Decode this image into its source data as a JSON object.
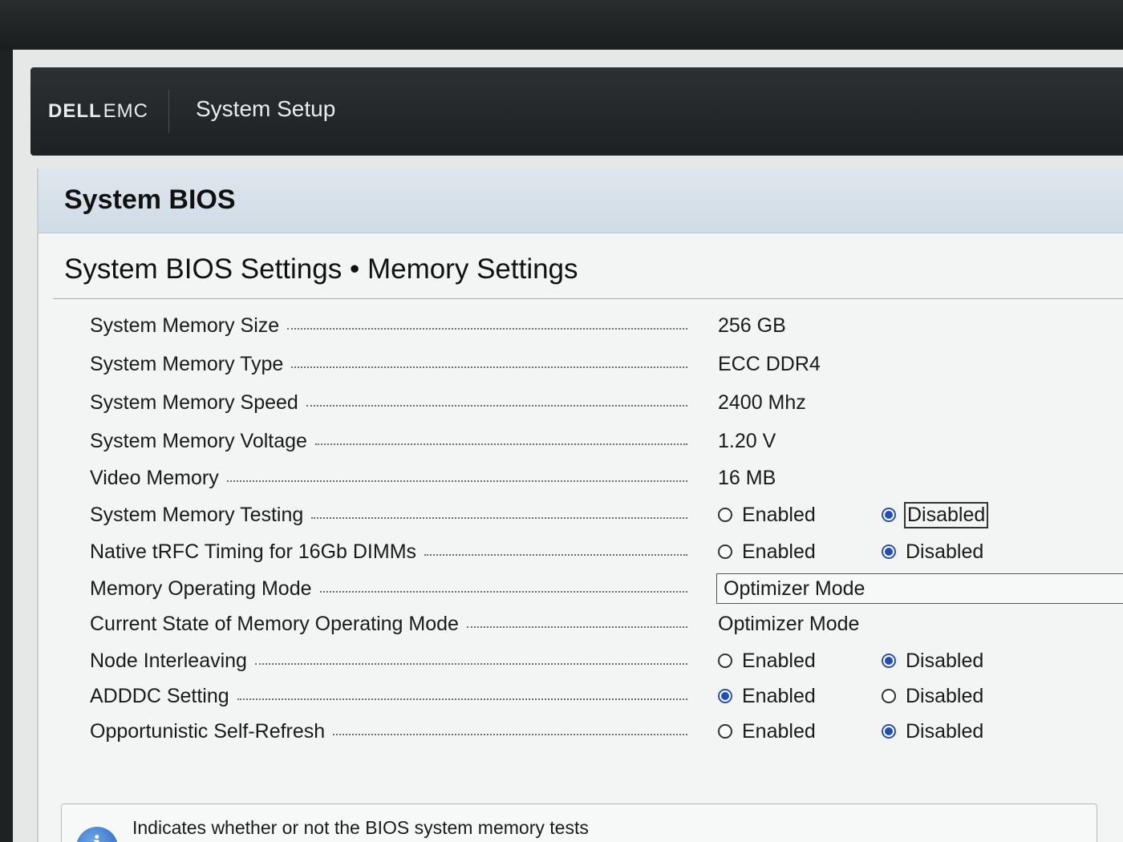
{
  "header": {
    "brand_dell": "DELL",
    "brand_emc": "EMC",
    "title": "System Setup"
  },
  "panel": {
    "title": "System BIOS",
    "page_title": "System BIOS Settings • Memory Settings"
  },
  "settings": [
    {
      "label": "System Memory Size",
      "value": "256 GB"
    },
    {
      "label": "System Memory Type",
      "value": "ECC DDR4"
    },
    {
      "label": "System Memory Speed",
      "value": "2400 Mhz"
    },
    {
      "label": "System Memory Voltage",
      "value": "1.20 V"
    },
    {
      "label": "Video Memory",
      "value": "16 MB"
    },
    {
      "label": "System Memory Testing",
      "opt1": "Enabled",
      "opt2": "Disabled",
      "selected": "Disabled"
    },
    {
      "label": "Native tRFC Timing for 16Gb DIMMs",
      "opt1": "Enabled",
      "opt2": "Disabled",
      "selected": "Disabled"
    },
    {
      "label": "Memory Operating Mode",
      "dropdown": "Optimizer Mode"
    },
    {
      "label": "Current State of Memory Operating Mode",
      "value": "Optimizer Mode"
    },
    {
      "label": "Node Interleaving",
      "opt1": "Enabled",
      "opt2": "Disabled",
      "selected": "Disabled"
    },
    {
      "label": "ADDDC Setting",
      "opt1": "Enabled",
      "opt2": "Disabled",
      "selected": "Enabled"
    },
    {
      "label": "Opportunistic Self-Refresh",
      "opt1": "Enabled",
      "opt2": "Disabled",
      "selected": "Disabled"
    }
  ],
  "help": {
    "icon": "info-icon",
    "text": "Indicates whether or not the BIOS system memory tests"
  },
  "colors": {
    "topbar": "#1e2123",
    "header_band": "#cfdbe6",
    "radio_selected": "#1f4fb5"
  }
}
